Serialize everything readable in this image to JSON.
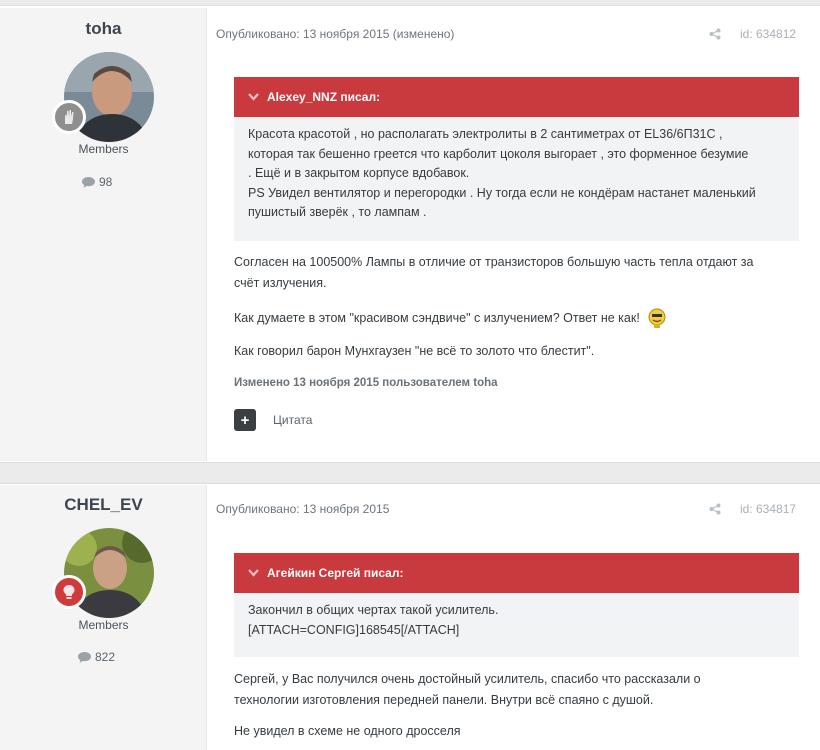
{
  "posts": [
    {
      "author": "toha",
      "group": "Members",
      "post_count": "98",
      "published": "Опубликовано: 13 ноября 2015 (изменено)",
      "post_id": "id: 634812",
      "quote": {
        "header": "Alexey_NNZ писал:",
        "lines": [
          "Красота красотой , но располагать электролиты в 2 сантиметрах от EL36/6П31С ,",
          "которая так бешенно греется что карболит цоколя выгорает , это форменное безумие",
          ". Ещё и в закрытом корпусе вдобавок.",
          "PS Увидел вентилятор и перегородки . Ну тогда если не кондёрам настанет маленький",
          "пушистый зверёк , то лампам ."
        ]
      },
      "paragraphs": [
        "Согласен на 100500% Лампы в отличие от транзисторов большую часть тепла отдают за",
        "счёт излучения.",
        "Как думаете в этом \"красивом сэндвиче\" с излучением? Ответ не как!",
        "Как говорил барон Мунхгаузен \"не всё то золото что блестит\"."
      ],
      "edited": "Изменено 13 ноября 2015 пользователем toha",
      "quote_button": "Цитата"
    },
    {
      "author": "CHEL_EV",
      "group": "Members",
      "post_count": "822",
      "published": "Опубликовано: 13 ноября 2015",
      "post_id": "id: 634817",
      "quote": {
        "header": "Агейкин Сергей писал:",
        "lines": [
          "Закончил в общих чертах такой усилитель.",
          "[ATTACH=CONFIG]168545[/ATTACH]"
        ]
      },
      "paragraphs": [
        "Сергей, у Вас получился очень достойный усилитель, спасибо что рассказали о",
        "технологии изготовления передней панели. Внутри всё спаяно с душой.",
        "Не увидел в схеме не одного дросселя"
      ]
    }
  ],
  "colors": {
    "quote_header": "#c93a3f",
    "quote_body": "#f1f3f5",
    "author_bg": "#f4f4f4",
    "badge_red": "#d03a3a",
    "badge_grey": "#8f8f8f"
  },
  "icons": [
    "chevron-down-icon",
    "share-icon",
    "comment-bubble-icon",
    "plus-icon",
    "hand-badge-icon",
    "lightbulb-badge-icon",
    "emoji-icon"
  ]
}
